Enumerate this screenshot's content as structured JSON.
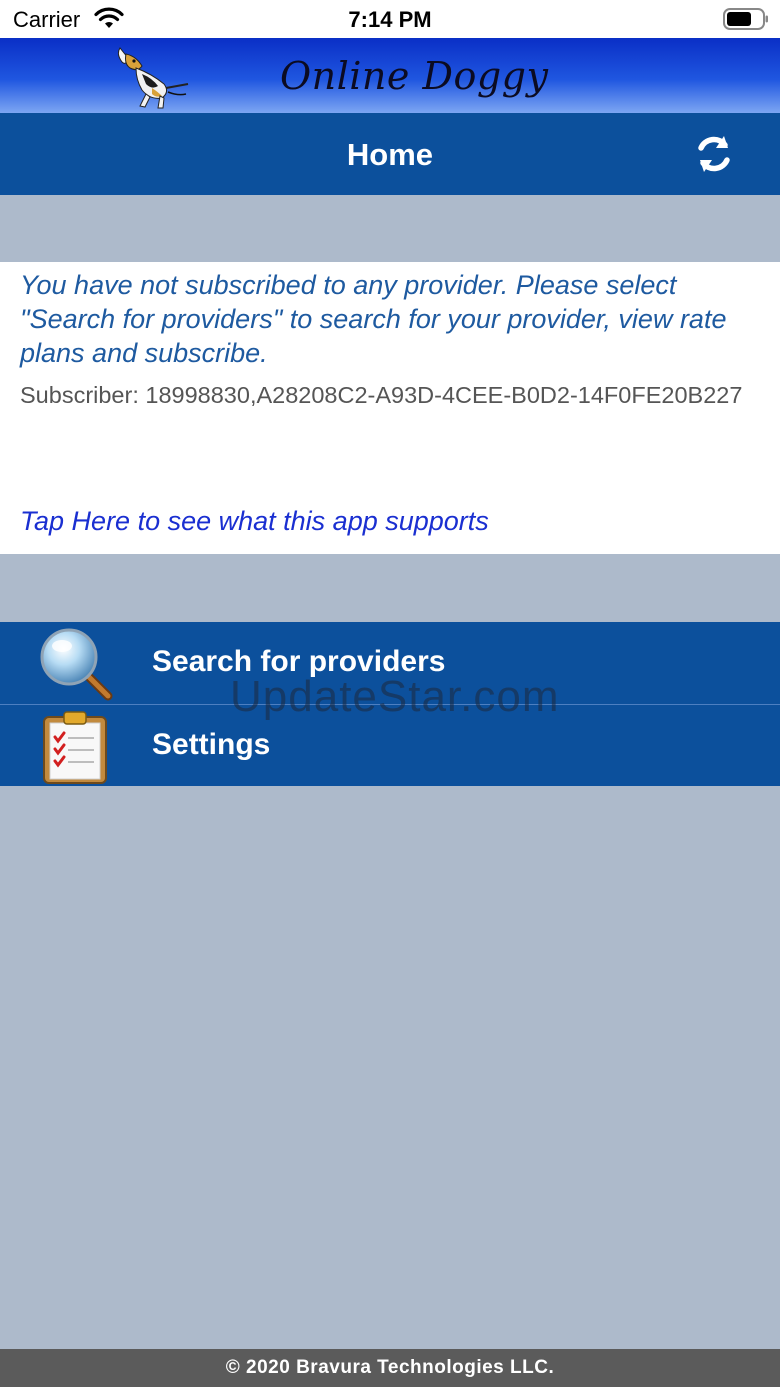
{
  "status_bar": {
    "carrier": "Carrier",
    "time": "7:14 PM"
  },
  "banner": {
    "title": "Online Doggy"
  },
  "navbar": {
    "title": "Home",
    "refresh_icon": "refresh-icon"
  },
  "info": {
    "notice": "You have not subscribed to any provider. Please select \"Search for providers\" to search for your provider, view rate plans and subscribe.",
    "subscriber": "Subscriber: 18998830,A28208C2-A93D-4CEE-B0D2-14F0FE20B227",
    "tap_link": "Tap Here to see what this app supports"
  },
  "menu": {
    "items": [
      {
        "label": "Search for providers",
        "icon": "magnifier-icon"
      },
      {
        "label": "Settings",
        "icon": "clipboard-icon"
      }
    ]
  },
  "watermark": "UpdateStar.com",
  "footer": {
    "copyright": "© 2020 Bravura Technologies LLC."
  },
  "colors": {
    "nav_blue": "#0c509c",
    "background": "#adbacb",
    "notice_text": "#1e5aa0",
    "link_text": "#1a2fd1",
    "footer": "#5b5b5b"
  }
}
